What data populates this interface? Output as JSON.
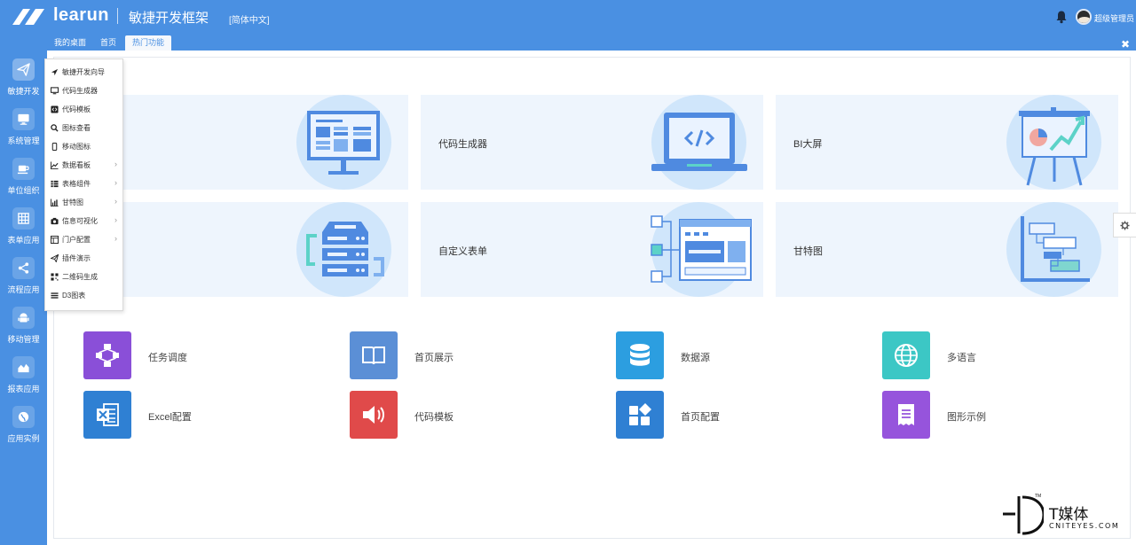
{
  "header": {
    "brand": "learun",
    "title": "敏捷开发框架",
    "lang": "[简体中文]",
    "username": "超级管理员"
  },
  "tabs": [
    {
      "label": "我的桌面"
    },
    {
      "label": "首页"
    },
    {
      "label": "热门功能",
      "active": true
    }
  ],
  "sidebar": {
    "items": [
      {
        "label": "敏捷开发",
        "icon": "paper-plane-icon",
        "active": true
      },
      {
        "label": "系统管理",
        "icon": "monitor-icon"
      },
      {
        "label": "单位组织",
        "icon": "coffee-cup-icon"
      },
      {
        "label": "表单应用",
        "icon": "table-grid-icon"
      },
      {
        "label": "流程应用",
        "icon": "share-nodes-icon"
      },
      {
        "label": "移动管理",
        "icon": "android-icon"
      },
      {
        "label": "报表应用",
        "icon": "area-chart-icon"
      },
      {
        "label": "应用实例",
        "icon": "globe-icon"
      }
    ]
  },
  "dropdown": {
    "items": [
      {
        "label": "敏捷开发向导",
        "icon": "location-arrow-icon",
        "has_sub": false
      },
      {
        "label": "代码生成器",
        "icon": "desktop-icon",
        "has_sub": false
      },
      {
        "label": "代码模板",
        "icon": "code-square-icon",
        "has_sub": false
      },
      {
        "label": "图标查看",
        "icon": "magnifier-icon",
        "has_sub": false
      },
      {
        "label": "移动图标",
        "icon": "mobile-icon",
        "has_sub": false
      },
      {
        "label": "数据看板",
        "icon": "line-chart-icon",
        "has_sub": true
      },
      {
        "label": "表格组件",
        "icon": "list-table-icon",
        "has_sub": true
      },
      {
        "label": "甘特图",
        "icon": "bar-chart-icon",
        "has_sub": true
      },
      {
        "label": "信息可视化",
        "icon": "camera-icon",
        "has_sub": true
      },
      {
        "label": "门户配置",
        "icon": "window-icon",
        "has_sub": true
      },
      {
        "label": "插件演示",
        "icon": "send-icon",
        "has_sub": false
      },
      {
        "label": "二维码生成",
        "icon": "qrcode-icon",
        "has_sub": false
      },
      {
        "label": "D3图表",
        "icon": "bars-icon",
        "has_sub": false
      }
    ]
  },
  "cards": [
    {
      "label": "",
      "illus": "dashboard-monitor"
    },
    {
      "label": "代码生成器",
      "illus": "laptop-code"
    },
    {
      "label": "BI大屏",
      "illus": "presentation-board"
    },
    {
      "label": "",
      "illus": "server-sync"
    },
    {
      "label": "自定义表单",
      "illus": "form-builder"
    },
    {
      "label": "甘特图",
      "illus": "gantt-chart"
    }
  ],
  "shortcuts": [
    {
      "label": "任务调度",
      "icon": "workflow-icon",
      "color": "#8a4fd8"
    },
    {
      "label": "首页展示",
      "icon": "book-icon",
      "color": "#5b8fd6"
    },
    {
      "label": "数据源",
      "icon": "database-icon",
      "color": "#2c9ee0"
    },
    {
      "label": "多语言",
      "icon": "globe-icon",
      "color": "#3cc7c5"
    },
    {
      "label": "Excel配置",
      "icon": "excel-icon",
      "color": "#2f80d3"
    },
    {
      "label": "代码模板",
      "icon": "speaker-icon",
      "color": "#e04a4a"
    },
    {
      "label": "首页配置",
      "icon": "widgets-icon",
      "color": "#2f80d3"
    },
    {
      "label": "图形示例",
      "icon": "receipt-icon",
      "color": "#9654dc"
    }
  ],
  "watermark": {
    "title": "T媒体",
    "sub": "CNITEYES.COM",
    "tm": "TM"
  },
  "colors": {
    "primary": "#4a90e2",
    "card_bg": "#eef5fd",
    "card_circle": "#d0e6fb"
  }
}
